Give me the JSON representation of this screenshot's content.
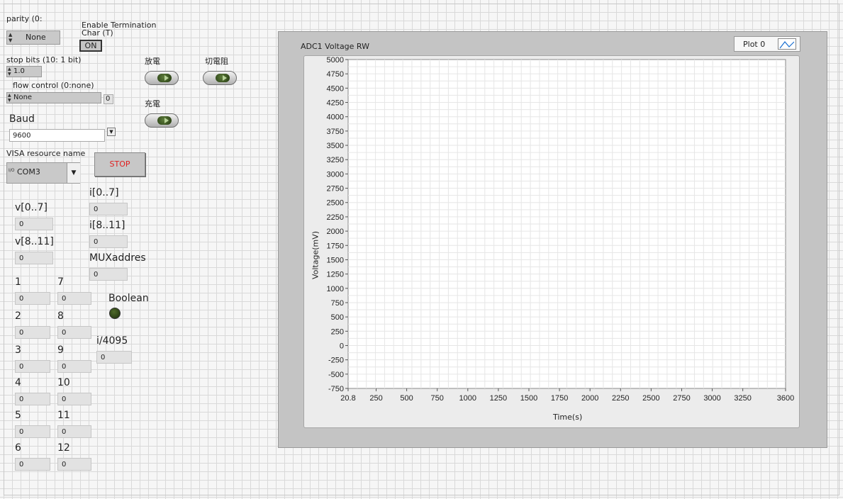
{
  "serial": {
    "parity": {
      "label": "parity (0:",
      "value": "None"
    },
    "termination": {
      "label_line1": "Enable Termination",
      "label_line2": "Char (T)",
      "value": "ON"
    },
    "stop_bits": {
      "label": "stop bits (10: 1 bit)",
      "value": "1.0"
    },
    "flow_control": {
      "label": "flow control (0:none)",
      "value": "None",
      "index": "0"
    },
    "baud": {
      "label": "Baud",
      "value": "9600"
    },
    "visa": {
      "label": "VISA resource name",
      "value": "COM3",
      "prefix": "I/O"
    },
    "stop_button": "STOP"
  },
  "switches": {
    "discharge": "放電",
    "cutoff": "切電阻",
    "charge": "充電"
  },
  "readouts": {
    "v07": {
      "label": "v[0..7]",
      "value": "0"
    },
    "v811": {
      "label": "v[8..11]",
      "value": "0"
    },
    "i07": {
      "label": "i[0..7]",
      "value": "0"
    },
    "i811": {
      "label": "i[8..11]",
      "value": "0"
    },
    "mux": {
      "label": "MUXaddres",
      "value": "0"
    },
    "boolean_label": "Boolean",
    "i4095": {
      "label": "i/4095",
      "value": "0"
    }
  },
  "channels": [
    {
      "label": "1",
      "value": "0"
    },
    {
      "label": "2",
      "value": "0"
    },
    {
      "label": "3",
      "value": "0"
    },
    {
      "label": "4",
      "value": "0"
    },
    {
      "label": "5",
      "value": "0"
    },
    {
      "label": "6",
      "value": "0"
    },
    {
      "label": "7",
      "value": "0"
    },
    {
      "label": "8",
      "value": "0"
    },
    {
      "label": "9",
      "value": "0"
    },
    {
      "label": "10",
      "value": "0"
    },
    {
      "label": "11",
      "value": "0"
    },
    {
      "label": "12",
      "value": "0"
    }
  ],
  "chart_data": {
    "type": "line",
    "title": "ADC1 Voltage RW",
    "legend_label": "Plot 0",
    "legend_position": "top-right",
    "xlabel": "Time(s)",
    "ylabel": "Voltage(mV)",
    "xlim": [
      20.8,
      3600
    ],
    "ylim": [
      -750,
      5000
    ],
    "x_ticks": [
      20.8,
      250,
      500,
      750,
      1000,
      1250,
      1500,
      1750,
      2000,
      2250,
      2500,
      2750,
      3000,
      3250,
      3600
    ],
    "y_ticks": [
      -750,
      -500,
      -250,
      0,
      250,
      500,
      750,
      1000,
      1250,
      1500,
      1750,
      2000,
      2250,
      2500,
      2750,
      3000,
      3250,
      3500,
      3750,
      4000,
      4250,
      4500,
      4750,
      5000
    ],
    "grid": true,
    "series": [
      {
        "name": "Plot 0",
        "x": [],
        "y": []
      }
    ],
    "colors": {
      "plot_bg": "#ffffff",
      "frame": "#c8c8c8",
      "grid": "#e6e6e6"
    }
  }
}
